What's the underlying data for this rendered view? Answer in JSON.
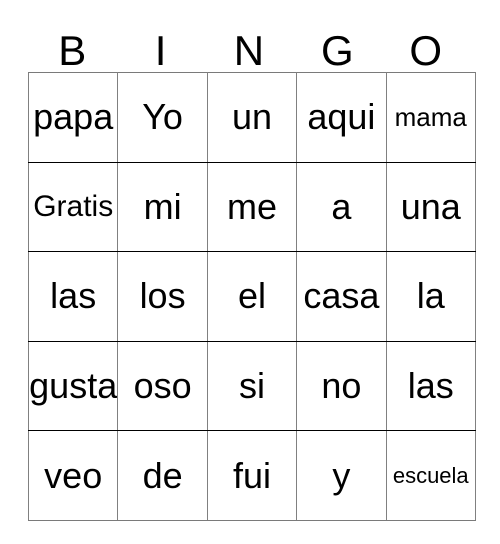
{
  "card": {
    "title_letters": [
      "B",
      "I",
      "N",
      "G",
      "O"
    ],
    "columns": 5,
    "rows": 5,
    "border_color": "#808080",
    "text_color": "#000000",
    "background_color": "#ffffff",
    "cells": [
      [
        {
          "text": "papa",
          "size": "lg"
        },
        {
          "text": "Yo",
          "size": "lg"
        },
        {
          "text": "un",
          "size": "lg"
        },
        {
          "text": "aqui",
          "size": "lg"
        },
        {
          "text": "mama",
          "size": "sm"
        }
      ],
      [
        {
          "text": "Gratis",
          "size": "md"
        },
        {
          "text": "mi",
          "size": "lg"
        },
        {
          "text": "me",
          "size": "lg"
        },
        {
          "text": "a",
          "size": "lg"
        },
        {
          "text": "una",
          "size": "lg"
        }
      ],
      [
        {
          "text": "las",
          "size": "lg"
        },
        {
          "text": "los",
          "size": "lg"
        },
        {
          "text": "el",
          "size": "lg"
        },
        {
          "text": "casa",
          "size": "lg"
        },
        {
          "text": "la",
          "size": "lg"
        }
      ],
      [
        {
          "text": "gusta",
          "size": "lg"
        },
        {
          "text": "oso",
          "size": "lg"
        },
        {
          "text": "si",
          "size": "lg"
        },
        {
          "text": "no",
          "size": "lg"
        },
        {
          "text": "las",
          "size": "lg"
        }
      ],
      [
        {
          "text": "veo",
          "size": "lg"
        },
        {
          "text": "de",
          "size": "lg"
        },
        {
          "text": "fui",
          "size": "lg"
        },
        {
          "text": "y",
          "size": "lg"
        },
        {
          "text": "escuela",
          "size": "xs"
        }
      ]
    ]
  }
}
